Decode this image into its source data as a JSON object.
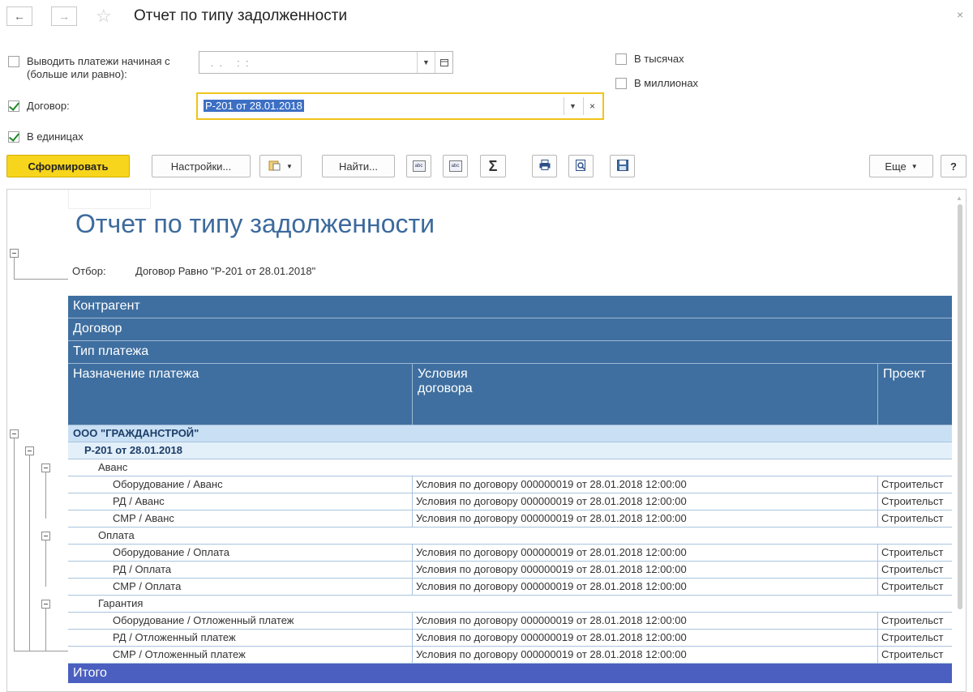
{
  "window": {
    "title": "Отчет по типу задолженности",
    "back_icon": "←",
    "forward_icon": "→",
    "favorite_icon": "☆",
    "close_icon": "×"
  },
  "params": {
    "payments_from_label": "Выводить платежи начиная с (больше или равно):",
    "date_value": " .  .     :  :",
    "in_thousands_label": "В тысячах",
    "in_millions_label": "В миллионах",
    "contract_label": "Договор:",
    "contract_value": "Р-201 от 28.01.2018",
    "in_units_label": "В единицах"
  },
  "toolbar": {
    "generate_label": "Сформировать",
    "settings_label": "Настройки...",
    "find_label": "Найти...",
    "sum_label": "Σ",
    "more_label": "Еще",
    "help_label": "?"
  },
  "report": {
    "title": "Отчет по типу задолженности",
    "filter_label": "Отбор:",
    "filter_value": "Договор Равно \"Р-201 от 28.01.2018\"",
    "headers": {
      "counterparty": "Контрагент",
      "contract": "Договор",
      "payment_type": "Тип платежа",
      "purpose": "Назначение платежа",
      "conditions": "Условия договора",
      "project": "Проект"
    },
    "counterparty": "ООО \"ГРАЖДАНСТРОЙ\"",
    "contract": "Р-201 от 28.01.2018",
    "groups": [
      {
        "name": "Аванс",
        "rows": [
          {
            "purpose": "Оборудование / Аванс",
            "conditions": "Условия по договору 000000019 от 28.01.2018 12:00:00",
            "project": "Строительст"
          },
          {
            "purpose": "РД / Аванс",
            "conditions": "Условия по договору 000000019 от 28.01.2018 12:00:00",
            "project": "Строительст"
          },
          {
            "purpose": "СМР / Аванс",
            "conditions": "Условия по договору 000000019 от 28.01.2018 12:00:00",
            "project": "Строительст"
          }
        ]
      },
      {
        "name": "Оплата",
        "rows": [
          {
            "purpose": "Оборудование / Оплата",
            "conditions": "Условия по договору 000000019 от 28.01.2018 12:00:00",
            "project": "Строительст"
          },
          {
            "purpose": "РД / Оплата",
            "conditions": "Условия по договору 000000019 от 28.01.2018 12:00:00",
            "project": "Строительст"
          },
          {
            "purpose": "СМР / Оплата",
            "conditions": "Условия по договору 000000019 от 28.01.2018 12:00:00",
            "project": "Строительст"
          }
        ]
      },
      {
        "name": "Гарантия",
        "rows": [
          {
            "purpose": "Оборудование / Отложенный платеж",
            "conditions": "Условия по договору 000000019 от 28.01.2018 12:00:00",
            "project": "Строительст"
          },
          {
            "purpose": "РД / Отложенный платеж",
            "conditions": "Условия по договору 000000019 от 28.01.2018 12:00:00",
            "project": "Строительст"
          },
          {
            "purpose": "СМР / Отложенный платеж",
            "conditions": "Условия по договору 000000019 от 28.01.2018 12:00:00",
            "project": "Строительст"
          }
        ]
      }
    ],
    "total_label": "Итого"
  },
  "colors": {
    "header_bg": "#3f6fa0",
    "group1_bg": "#c9e0f4",
    "group2_bg": "#e3f0fa",
    "total_bg": "#4a5fbf",
    "primary_button": "#f7d51c",
    "focus_border": "#f0c419"
  }
}
